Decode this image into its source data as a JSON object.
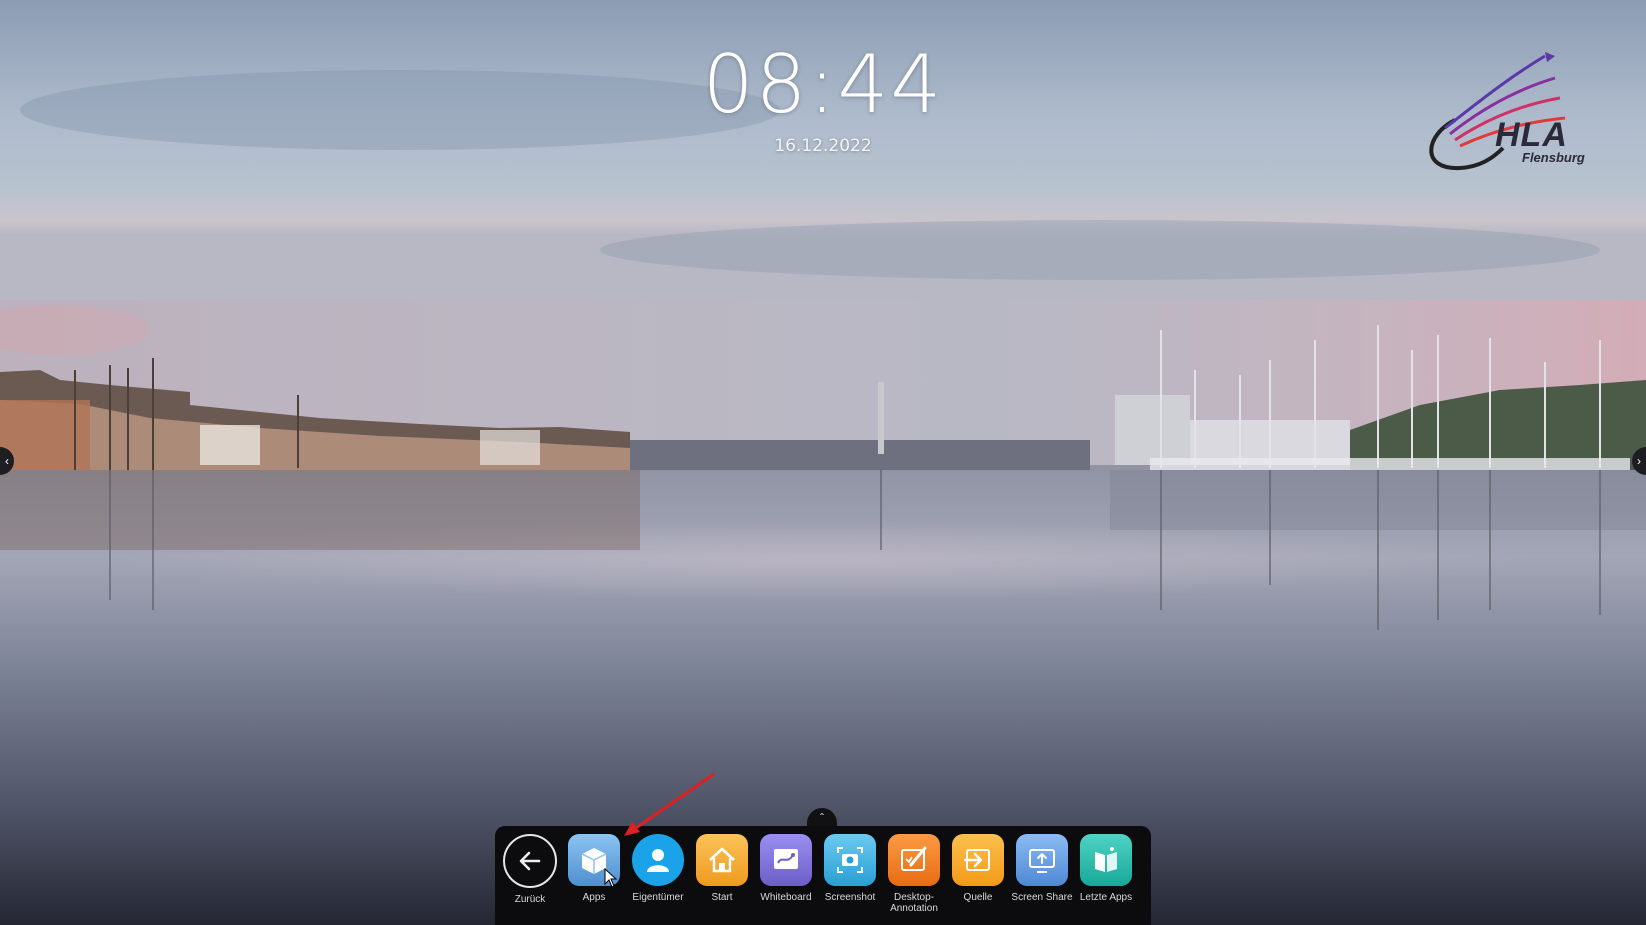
{
  "clock": {
    "time": "08:44",
    "date": "16.12.2022"
  },
  "logo": {
    "text": "HLA",
    "subtext": "Flensburg"
  },
  "dock": {
    "items": [
      {
        "label": "Zurück",
        "icon": "back-arrow-icon",
        "color": "#ffffff"
      },
      {
        "label": "Apps",
        "icon": "apps-cube-icon",
        "color": "#5b9bd5"
      },
      {
        "label": "Eigentümer",
        "icon": "owner-person-icon",
        "color": "#1aa3e8"
      },
      {
        "label": "Start",
        "icon": "home-icon",
        "color": "#f5a623"
      },
      {
        "label": "Whiteboard",
        "icon": "whiteboard-icon",
        "color": "#7b6fd6"
      },
      {
        "label": "Screenshot",
        "icon": "camera-icon",
        "color": "#3ab0e0"
      },
      {
        "label": "Desktop-Annotation",
        "icon": "annotation-pen-icon",
        "color": "#f07f24"
      },
      {
        "label": "Quelle",
        "icon": "source-input-icon",
        "color": "#f5a623"
      },
      {
        "label": "Screen Share",
        "icon": "screen-share-icon",
        "color": "#5a9be0"
      },
      {
        "label": "Letzte Apps",
        "icon": "recent-apps-icon",
        "color": "#23b7a8"
      }
    ]
  },
  "annotation": {
    "color": "#e02020"
  }
}
